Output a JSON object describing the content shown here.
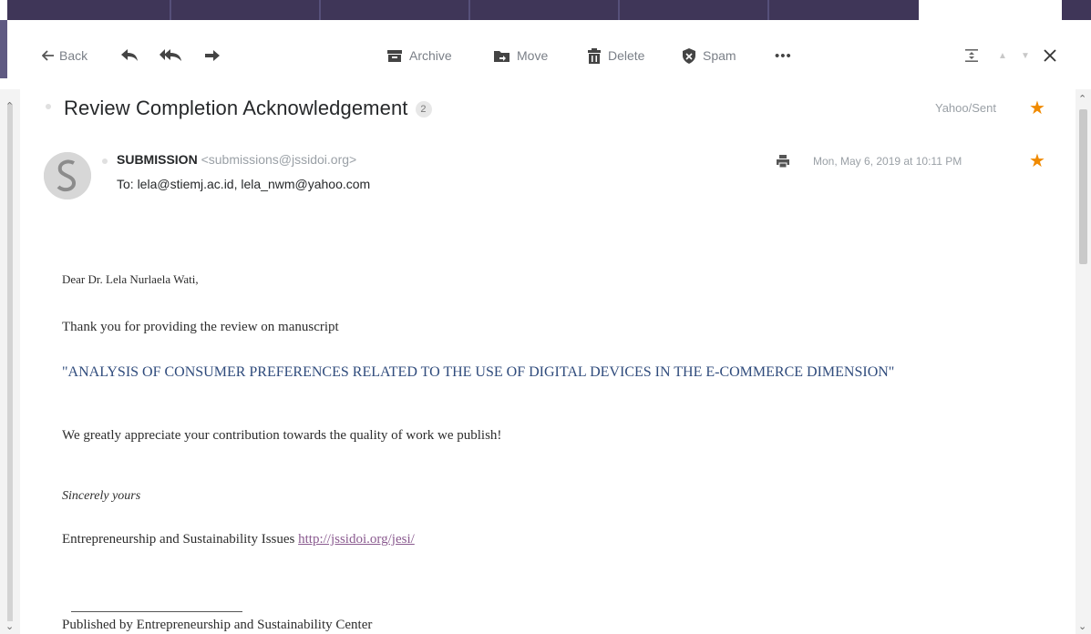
{
  "toolbar": {
    "back": "Back",
    "archive": "Archive",
    "move": "Move",
    "delete": "Delete",
    "spam": "Spam",
    "more": "•••"
  },
  "message": {
    "subject": "Review Completion Acknowledgement",
    "count": "2",
    "folder": "Yahoo/Sent",
    "sender_name": "SUBMISSION",
    "sender_email": "<submissions@jssidoi.org>",
    "recipients": "To: lela@stiemj.ac.id,  lela_nwm@yahoo.com",
    "date": "Mon, May 6, 2019 at 10:11 PM"
  },
  "body": {
    "greeting": "Dear Dr. Lela Nurlaela Wati,",
    "line1": "Thank you for providing the review on manuscript",
    "title": "\"ANALYSIS OF CONSUMER PREFERENCES RELATED TO THE USE OF DIGITAL DEVICES IN THE E-COMMERCE DIMENSION\"",
    "line2": "We greatly appreciate your contribution towards the quality of work we publish!",
    "signoff": "Sincerely yours",
    "journal": "Entrepreneurship and Sustainability Issues",
    "journal_link": "http://jssidoi.org/jesi/",
    "footer": "Published by Entrepreneurship and Sustainability Center"
  },
  "colors": {
    "accent_purple": "#3f3658",
    "star": "#f08a00",
    "title_blue": "#2f4b7c"
  }
}
